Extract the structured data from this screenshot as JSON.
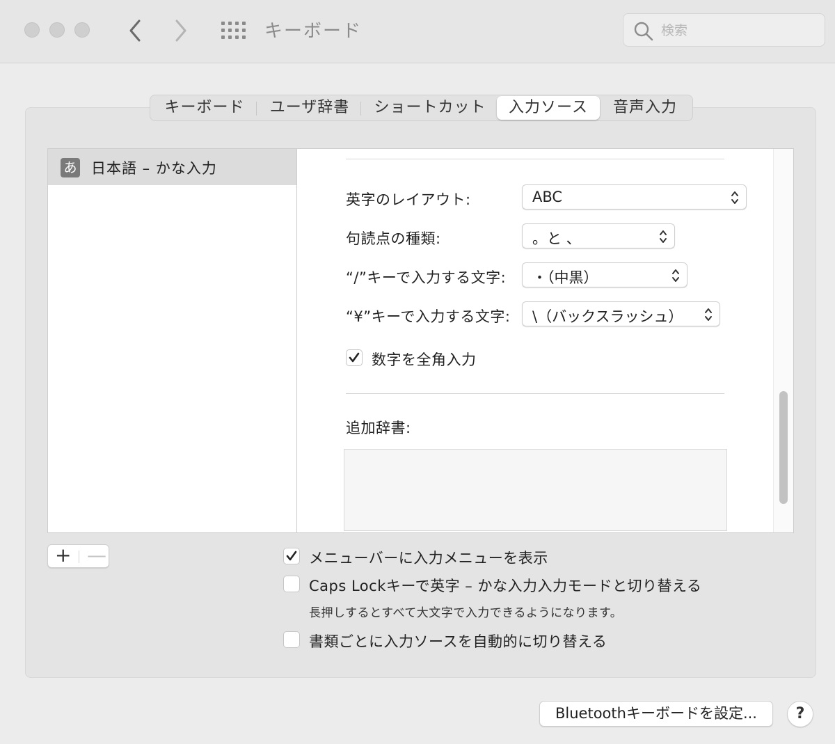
{
  "window": {
    "title": "キーボード"
  },
  "search": {
    "placeholder": "検索"
  },
  "tabs": [
    {
      "label": "キーボード"
    },
    {
      "label": "ユーザ辞書"
    },
    {
      "label": "ショートカット"
    },
    {
      "label": "入力ソース",
      "active": true
    },
    {
      "label": "音声入力"
    }
  ],
  "sources": {
    "items": [
      {
        "icon_text": "あ",
        "label": "日本語 – かな入力",
        "selected": true
      }
    ]
  },
  "settings": {
    "layout_label": "英字のレイアウト:",
    "layout_value": "ABC",
    "punct_label": "句読点の種類:",
    "punct_value": "。と 、",
    "slash_label": "“/”キーで入力する文字:",
    "slash_value": "・（中黒）",
    "yen_label": "“¥”キーで入力する文字:",
    "yen_value": "\\（バックスラッシュ）",
    "fullwidth_label": "数字を全角入力",
    "fullwidth_checked": true,
    "dict_label": "追加辞書:"
  },
  "list_controls": {
    "add": "+",
    "remove": "—"
  },
  "options": {
    "show_menu_label": "メニューバーに入力メニューを表示",
    "show_menu_checked": true,
    "capslock_label": "Caps Lockキーで英字 – かな入力入力モードと切り替える",
    "capslock_checked": false,
    "capslock_note": "長押しするとすべて大文字で入力できるようになります。",
    "auto_switch_label": "書類ごとに入力ソースを自動的に切り替える",
    "auto_switch_checked": false
  },
  "footer": {
    "bluetooth_button": "Bluetoothキーボードを設定...",
    "help_button": "?"
  }
}
